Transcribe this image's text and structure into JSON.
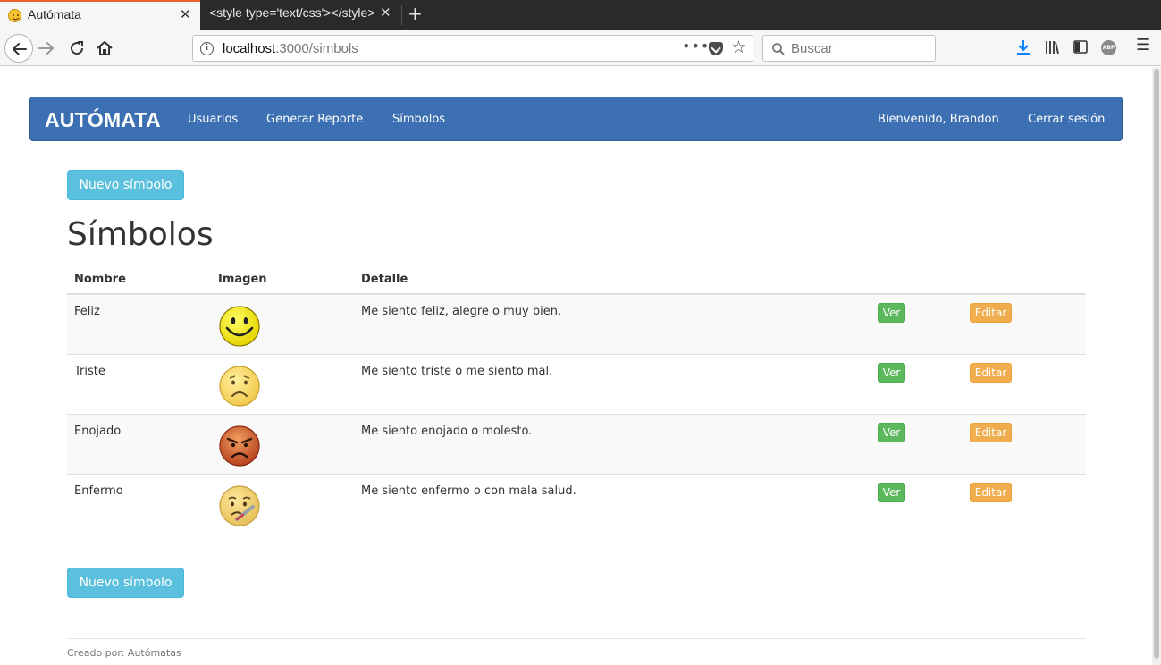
{
  "browser": {
    "tabs": [
      {
        "title": "Autómata",
        "active": true
      },
      {
        "title": "<style type='text/css'></style>",
        "active": false
      }
    ],
    "url_host": "localhost",
    "url_path": ":3000/simbols",
    "search_placeholder": "Buscar",
    "url_menu": "•••",
    "star_glyph": "☆",
    "close_glyph": "✕",
    "new_tab_glyph": "+",
    "menu_glyph": "☰",
    "adblock_label": "ABP",
    "info_glyph": "i"
  },
  "navbar": {
    "brand": "AUTÓMATA",
    "links": [
      "Usuarios",
      "Generar Reporte",
      "Símbolos"
    ],
    "welcome": "Bienvenido, Brandon",
    "logout": "Cerrar sesión",
    "color": "#3d70b2"
  },
  "page": {
    "new_button": "Nuevo símbolo",
    "title": "Símbolos"
  },
  "table": {
    "headers": [
      "Nombre",
      "Imagen",
      "Detalle"
    ],
    "rows": [
      {
        "name": "Feliz",
        "icon": "happy-face-icon",
        "detail": "Me siento feliz, alegre o muy bien.",
        "show": "Ver",
        "edit": "Editar"
      },
      {
        "name": "Triste",
        "icon": "sad-face-icon",
        "detail": "Me siento triste o me siento mal.",
        "show": "Ver",
        "edit": "Editar"
      },
      {
        "name": "Enojado",
        "icon": "angry-face-icon",
        "detail": "Me siento enojado o molesto.",
        "show": "Ver",
        "edit": "Editar"
      },
      {
        "name": "Enfermo",
        "icon": "sick-face-icon",
        "detail": "Me siento enfermo o con mala salud.",
        "show": "Ver",
        "edit": "Editar"
      }
    ]
  },
  "footer": {
    "text": "Creado por: Autómatas"
  }
}
